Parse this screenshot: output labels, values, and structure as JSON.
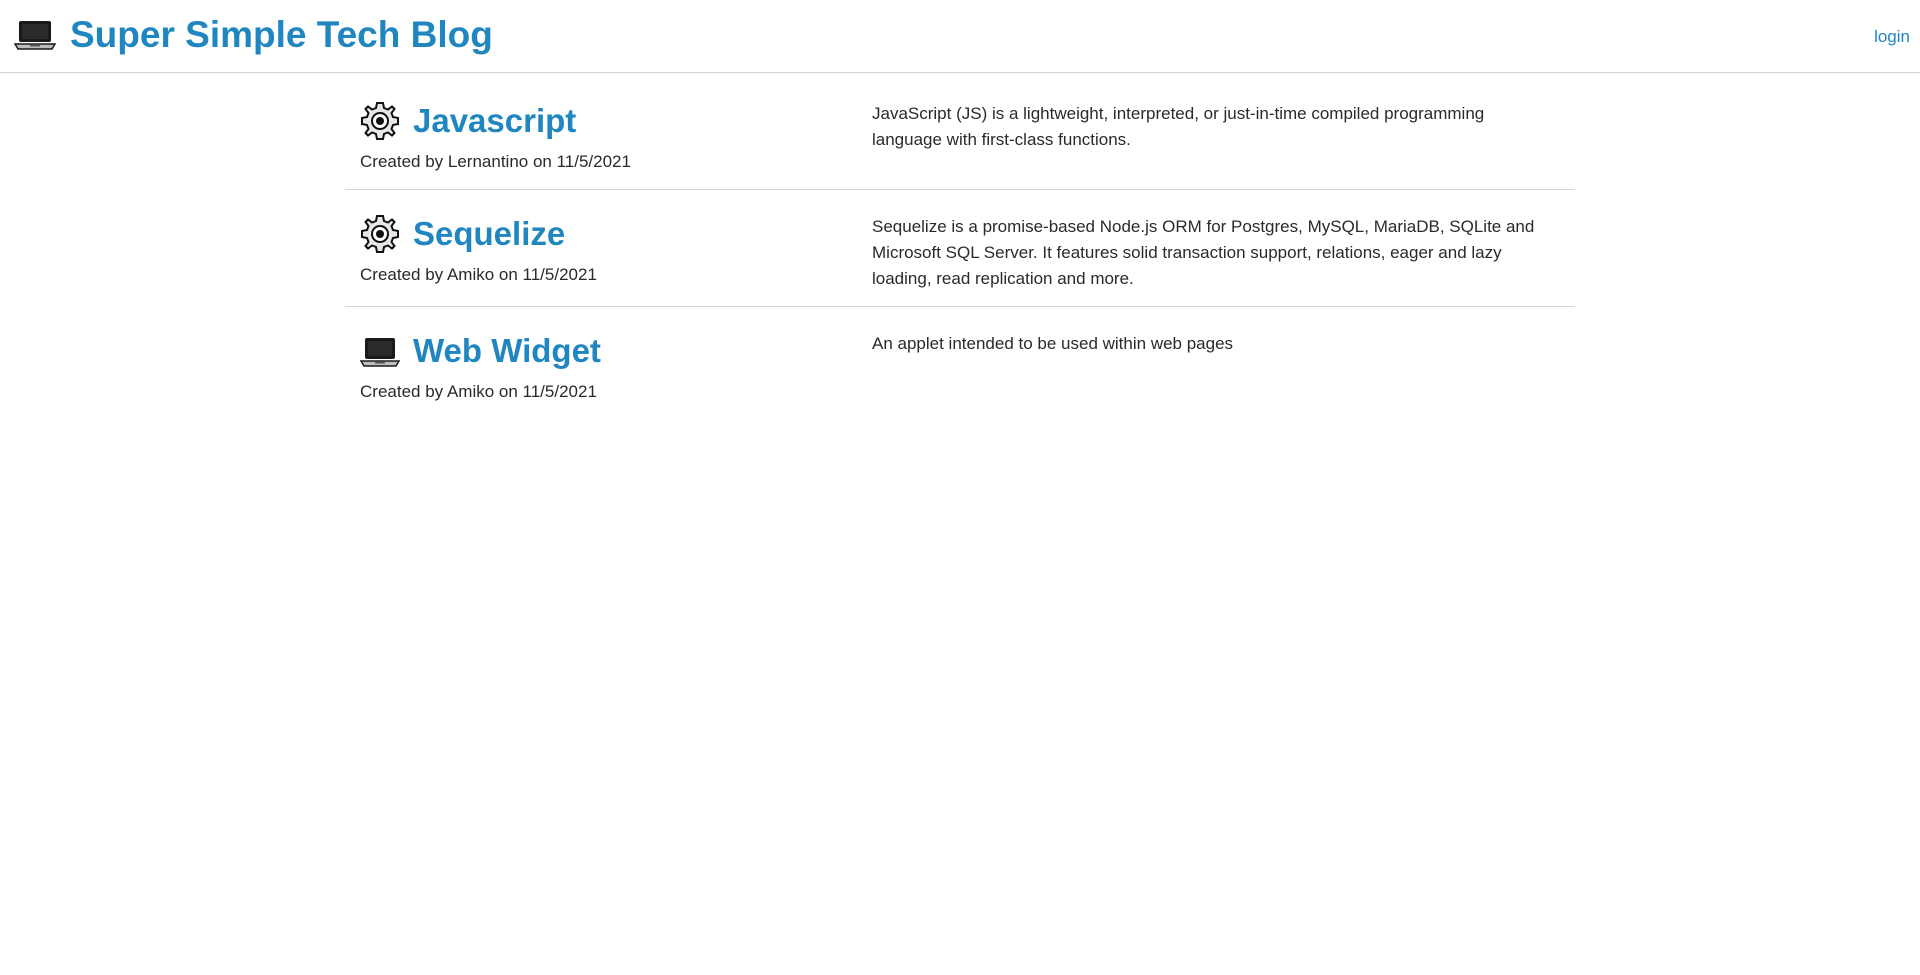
{
  "header": {
    "brand_icon": "laptop-icon",
    "title": "Super Simple Tech Blog",
    "login_label": "login",
    "accent_color": "#1f86c0"
  },
  "posts": [
    {
      "icon": "gear-icon",
      "title": "Javascript",
      "meta": "Created by Lernantino on 11/5/2021",
      "description": "JavaScript (JS) is a lightweight, interpreted, or just-in-time compiled programming language with first-class functions."
    },
    {
      "icon": "gear-icon",
      "title": "Sequelize",
      "meta": "Created by Amiko on 11/5/2021",
      "description": "Sequelize is a promise-based Node.js ORM for Postgres, MySQL, MariaDB, SQLite and Microsoft SQL Server. It features solid transaction support, relations, eager and lazy loading, read replication and more."
    },
    {
      "icon": "laptop-icon",
      "title": "Web Widget",
      "meta": "Created by Amiko on 11/5/2021",
      "description": "An applet intended to be used within web pages"
    }
  ]
}
